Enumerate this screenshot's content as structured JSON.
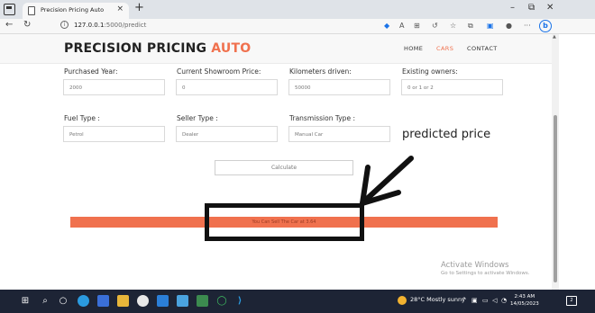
{
  "browser": {
    "tab_title": "Precision Pricing Auto",
    "tab_close": "×",
    "new_tab": "+",
    "url_host": "127.0.0.1",
    "url_rest": ":5000/predict",
    "window_controls": [
      "–",
      "⧉",
      "✕"
    ]
  },
  "site": {
    "logo_main": "PRECISION PRICING ",
    "logo_accent": "AUTO",
    "accent_color": "#f0714e",
    "nav": [
      "HOME",
      "CARS",
      "CONTACT"
    ],
    "active_nav": "CARS"
  },
  "form": {
    "row1": [
      {
        "label": "Purchased Year:",
        "value": "2000"
      },
      {
        "label": "Current Showroom Price:",
        "value": "0"
      },
      {
        "label": "Kilometers driven:",
        "value": "50000"
      },
      {
        "label": "Existing owners:",
        "value": "0 or 1 or 2"
      }
    ],
    "row2": [
      {
        "label": "Fuel Type :",
        "value": "Petrol"
      },
      {
        "label": "Seller Type :",
        "value": "Dealer"
      },
      {
        "label": "Transmission Type :",
        "value": "Manual Car"
      }
    ],
    "calculate_label": "Calculate",
    "result_text": "You Can Sell The Car at 3.64"
  },
  "annotation": {
    "text": "predicted price"
  },
  "watermark": {
    "line1": "Activate Windows",
    "line2": "Go to Settings to activate Windows."
  },
  "taskbar": {
    "weather": "28°C  Mostly sunny",
    "time": "2:43 AM",
    "date": "14/05/2023",
    "notification_count": "2"
  }
}
